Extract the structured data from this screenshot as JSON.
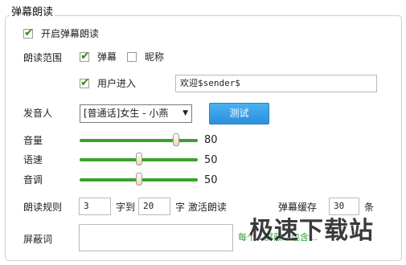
{
  "group_title": "弹幕朗读",
  "enable_reading": {
    "label": "开启弹幕朗读",
    "checked": true
  },
  "range": {
    "label": "朗读范围",
    "danmaku": {
      "label": "弹幕",
      "checked": true
    },
    "nickname": {
      "label": "昵称",
      "checked": false
    },
    "user_enter": {
      "label": "用户进入",
      "checked": true
    },
    "user_enter_template": "欢迎$sender$"
  },
  "speaker": {
    "label": "发音人",
    "selected": "[普通话]女生 - 小燕",
    "test_button": "测试"
  },
  "sliders": [
    {
      "label": "音量",
      "value": "80",
      "fraction": 0.8
    },
    {
      "label": "语速",
      "value": "50",
      "fraction": 0.5
    },
    {
      "label": "音调",
      "value": "50",
      "fraction": 0.5
    }
  ],
  "rules": {
    "label": "朗读规则",
    "min_chars": "3",
    "to_text": "字到",
    "max_chars": "20",
    "suffix": "字 激活朗读",
    "buffer_label": "弹幕缓存",
    "buffer_value": "30",
    "buffer_unit": "条"
  },
  "blocked_words": {
    "label": "屏蔽词",
    "value": "",
    "hint": "每个…屏蔽…包含…"
  },
  "watermark": "极速下载站",
  "colors": {
    "slider": "#3aa22b",
    "button": "#2d8fdb",
    "check": "#3a8a12"
  }
}
